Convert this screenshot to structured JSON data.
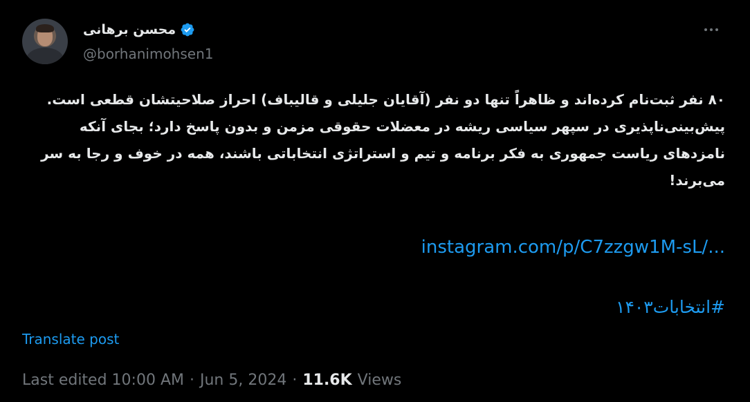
{
  "author": {
    "display_name": "محسن برهانی",
    "handle": "@borhanimohsen1",
    "verified": true
  },
  "post": {
    "lines": [
      "۸۰ نفر ثبت‌نام کرده‌اند و ظاهراً تنها دو نفر (آقایان جلیلی و قالیباف) احراز صلاحیتشان قطعی است.",
      "پیش‌بینی‌ناپذیری در سپهر سیاسی ریشه در معضلات حقوقی مزمن و بدون پاسخ دارد؛ بجای آنکه",
      "نامزدهای ریاست جمهوری به فکر برنامه و تیم و استراتژی انتخاباتی باشند، همه در خوف و رجا به سر",
      "می‌برند!"
    ],
    "link": "instagram.com/p/C7zzgw1M-sL/...",
    "hashtag": "#انتخابات۱۴۰۳",
    "translate_label": "Translate post"
  },
  "meta": {
    "edited": "Last edited 10:00 AM",
    "separator": "·",
    "date": "Jun 5, 2024",
    "views_count": "11.6K",
    "views_label": "Views"
  },
  "colors": {
    "background": "#000000",
    "text": "#e7e9ea",
    "muted": "#71767b",
    "accent": "#1d9bf0"
  }
}
